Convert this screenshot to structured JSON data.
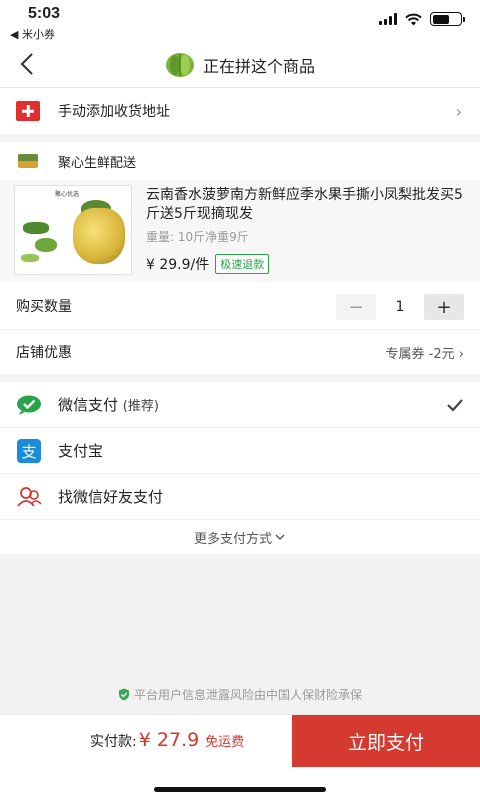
{
  "status_bar": {
    "time": "5:03",
    "back_app": "◀ 米小券"
  },
  "header": {
    "title": "正在拼这个商品"
  },
  "address": {
    "label": "手动添加收货地址"
  },
  "shop": {
    "name": "聚心生鲜配送",
    "product": {
      "thumb_title": "聚心优选",
      "title": "云南香水菠萝南方新鲜应季水果手撕小凤梨批发买5斤送5斤现摘现发",
      "weight": "重量: 10斤净重9斤",
      "price": "¥ 29.9/件",
      "badge": "极速退款"
    },
    "quantity": {
      "label": "购买数量",
      "value": "1",
      "minus": "−",
      "plus": "+"
    },
    "promo": {
      "label": "店铺优惠",
      "value": "专属券 -2元"
    }
  },
  "payment": {
    "options": [
      {
        "label": "微信支付",
        "sub": "(推荐)",
        "icon": "wechat-pay-icon",
        "selected": true
      },
      {
        "label": "支付宝",
        "icon": "alipay-icon",
        "selected": false
      },
      {
        "label": "找微信好友支付",
        "icon": "friends-icon",
        "selected": false
      }
    ],
    "more": "更多支付方式"
  },
  "notice": "平台用户信息泄露风险由中国人保财险承保",
  "footer": {
    "amount_label": "实付款:",
    "amount": "¥ 27.9",
    "shipping": "免运费",
    "pay_button": "立即支付"
  },
  "colors": {
    "accent": "#d53a30",
    "wechat": "#2aa34a",
    "alipay": "#1b8cdb"
  }
}
